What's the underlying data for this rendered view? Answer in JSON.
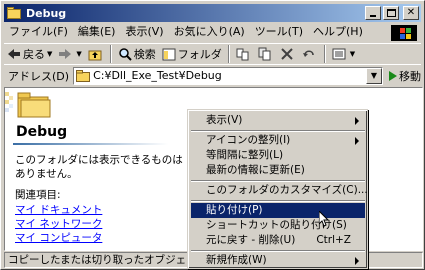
{
  "window": {
    "title": "Debug"
  },
  "menubar": {
    "items": [
      {
        "label": "ファイル(F)"
      },
      {
        "label": "編集(E)"
      },
      {
        "label": "表示(V)"
      },
      {
        "label": "お気に入り(A)"
      },
      {
        "label": "ツール(T)"
      },
      {
        "label": "ヘルプ(H)"
      }
    ]
  },
  "toolbar": {
    "back_label": "戻る",
    "search_label": "検索",
    "folders_label": "フォルダ"
  },
  "address": {
    "label": "アドレス(D)",
    "value": "C:¥Dll_Exe_Test¥Debug",
    "go_label": "移動"
  },
  "content": {
    "folder_title": "Debug",
    "empty_message": "このフォルダには表示できるものはありません。",
    "related_heading": "関連項目:",
    "links": [
      "マイ ドキュメント",
      "マイ ネットワーク",
      "マイ コンピュータ"
    ]
  },
  "statusbar": {
    "text": "コピーしたまたは切り取ったオブジェクトを、選択さ"
  },
  "context_menu": {
    "items": [
      {
        "label": "表示(V)"
      },
      {
        "label": "アイコンの整列(I)"
      },
      {
        "label": "等間隔に整列(L)"
      },
      {
        "label": "最新の情報に更新(E)"
      },
      {
        "label": "このフォルダのカスタマイズ(C)..."
      },
      {
        "label": "貼り付け(P)"
      },
      {
        "label": "ショートカットの貼り付け(S)"
      },
      {
        "label": "元に戻す - 削除(U)",
        "shortcut": "Ctrl+Z"
      },
      {
        "label": "新規作成(W)"
      }
    ]
  },
  "colors": {
    "titlebar_start": "#0a246a",
    "titlebar_end": "#a6caf0",
    "highlight": "#0a246a",
    "link": "#0000ff",
    "face": "#d4d0c8"
  },
  "icons": [
    "folder-icon",
    "back-arrow-icon",
    "forward-arrow-icon",
    "up-folder-icon",
    "search-icon",
    "folders-icon",
    "move-to-icon",
    "copy-to-icon",
    "delete-icon",
    "undo-icon",
    "views-icon",
    "go-arrow-icon",
    "windows-logo-icon",
    "mouse-cursor-icon"
  ]
}
